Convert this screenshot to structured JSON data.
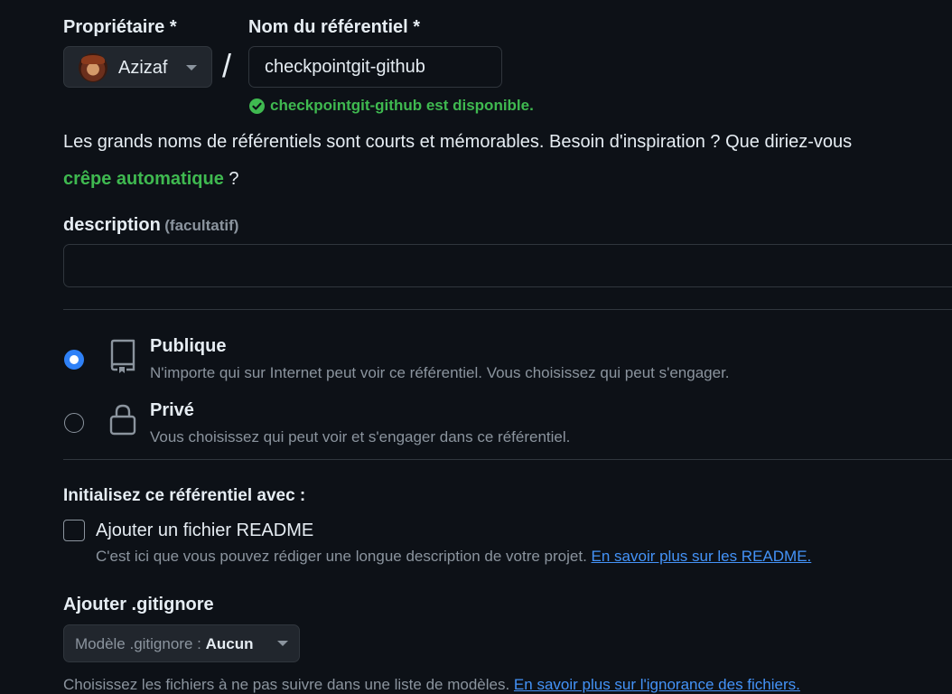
{
  "owner": {
    "label": "Propriétaire *",
    "name": "Azizaf"
  },
  "separator": "/",
  "repo": {
    "label": "Nom du référentiel *",
    "value": "checkpointgit-github",
    "availability": "checkpointgit-github est disponible."
  },
  "hint": {
    "line1": "Les grands noms de référentiels sont courts et mémorables. Besoin d'inspiration ? Que diriez-vous",
    "suggestion": "crêpe automatique",
    "suffix": " ?"
  },
  "description": {
    "label": "description",
    "optional": "(facultatif)",
    "value": ""
  },
  "visibility": {
    "options": [
      {
        "title": "Publique",
        "desc": "N'importe qui sur Internet peut voir ce référentiel. Vous choisissez qui peut s'engager.",
        "selected": true
      },
      {
        "title": "Privé",
        "desc": "Vous choisissez qui peut voir et s'engager dans ce référentiel.",
        "selected": false
      }
    ]
  },
  "init": {
    "heading": "Initialisez ce référentiel avec :",
    "readme_label": "Ajouter un fichier README",
    "readme_checked": false,
    "readme_desc": "C'est ici que vous pouvez rédiger une longue description de votre projet. ",
    "readme_link": "En savoir plus sur les README."
  },
  "gitignore": {
    "heading": "Ajouter .gitignore",
    "button_prefix": "Modèle .gitignore : ",
    "button_value": "Aucun",
    "desc": "Choisissez les fichiers à ne pas suivre dans une liste de modèles. ",
    "link": "En savoir plus sur l'ignorance des fichiers."
  },
  "colors": {
    "background": "#0d1117",
    "accent_blue": "#2f81f7",
    "success_green": "#3fb950",
    "border": "#30363d"
  },
  "icons": {
    "public": "repo-icon",
    "private": "lock-icon",
    "availability": "check-circle-icon",
    "dropdown": "triangle-down-icon"
  }
}
